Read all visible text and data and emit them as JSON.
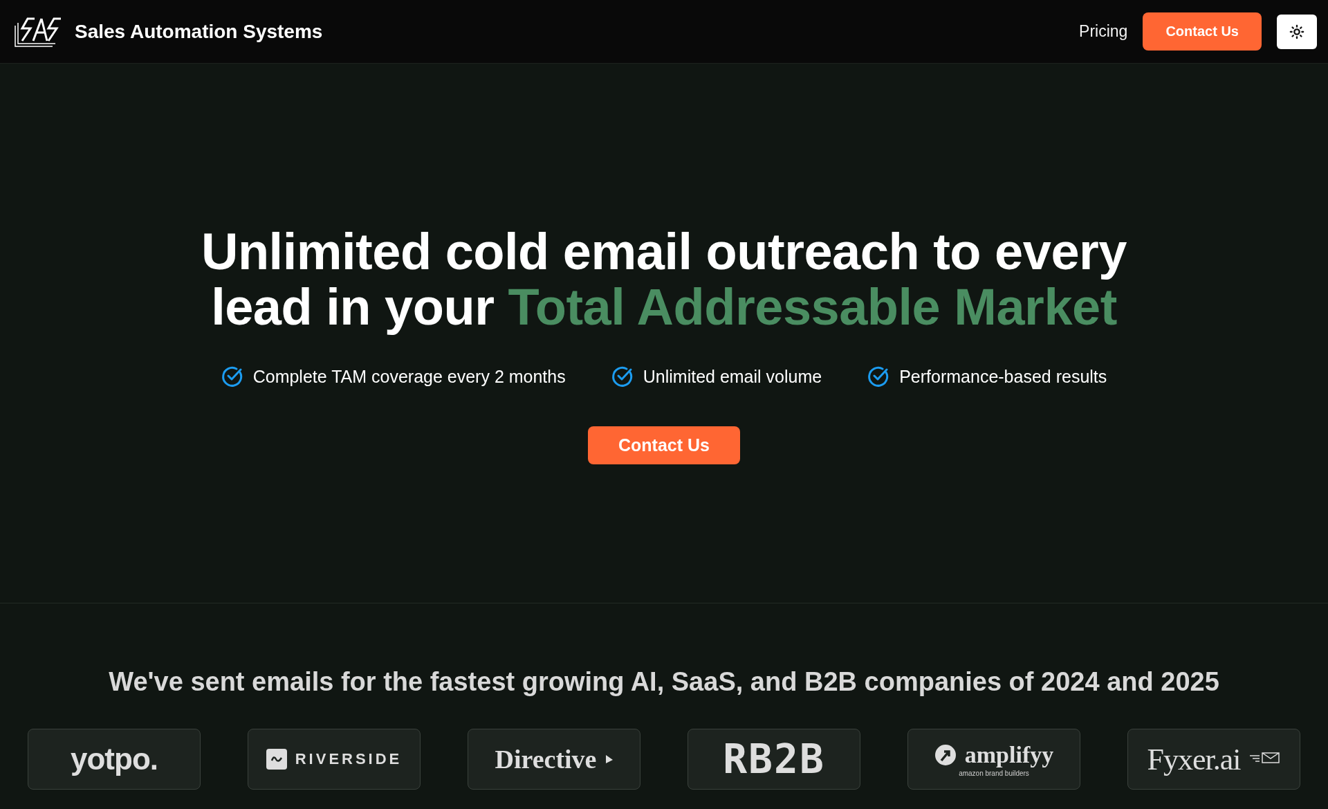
{
  "header": {
    "brand": "Sales Automation Systems",
    "nav": [
      {
        "kind": "link",
        "label": "Pricing"
      },
      {
        "kind": "button",
        "label": "Contact Us"
      },
      {
        "kind": "theme-toggle"
      }
    ]
  },
  "hero": {
    "headline": [
      {
        "text": "Unlimited cold email outreach to every lead in your ",
        "highlight": false
      },
      {
        "text": "Total Addressable Market",
        "highlight": true
      }
    ],
    "features": [
      "Complete TAM coverage every 2 months",
      "Unlimited email volume",
      "Performance-based results"
    ],
    "cta": "Contact Us"
  },
  "clients": {
    "title": "We've sent emails for the fastest growing AI, SaaS, and B2B companies of 2024 and 2025",
    "logos": [
      {
        "kind": "yotpo",
        "name": "yotpo."
      },
      {
        "kind": "riverside",
        "name": "RIVERSIDE"
      },
      {
        "kind": "directive",
        "name": "Directive"
      },
      {
        "kind": "rb2b",
        "name": "RB2B"
      },
      {
        "kind": "amplifyy",
        "name": "amplifyy",
        "tagline": "amazon brand builders"
      },
      {
        "kind": "fyxer",
        "name": "Fyxer.ai"
      }
    ]
  }
}
